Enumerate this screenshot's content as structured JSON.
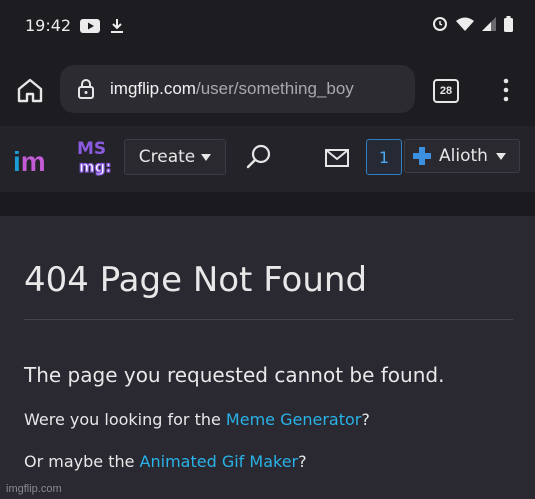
{
  "status_bar": {
    "time": "19:42",
    "icons": [
      "youtube-icon",
      "download-icon",
      "alarm-icon",
      "wifi-icon",
      "signal-icon",
      "battery-icon"
    ]
  },
  "browser": {
    "url_host": "imgflip.com",
    "url_path": "/user/something_boy",
    "tab_count": "28"
  },
  "site_nav": {
    "logo_i": "i",
    "logo_m": "m",
    "badge_text_top": "MS",
    "badge_text_bottom": "mg:",
    "create_label": "Create",
    "notification_count": "1",
    "username": "Alioth"
  },
  "content": {
    "title": "404 Page Not Found",
    "message": "The page you requested cannot be found.",
    "q1_prefix": "Were you looking for the ",
    "q1_link": "Meme Generator",
    "q1_suffix": "?",
    "q2_prefix": "Or maybe the ",
    "q2_link": "Animated Gif Maker",
    "q2_suffix": "?"
  },
  "watermark": "imgflip.com",
  "colors": {
    "link": "#29b3e8",
    "logo_i": "#1b9dd6",
    "logo_m": "#c45bd6",
    "badge": "#7b4fd6",
    "user_plus": "#3d8fe0"
  }
}
